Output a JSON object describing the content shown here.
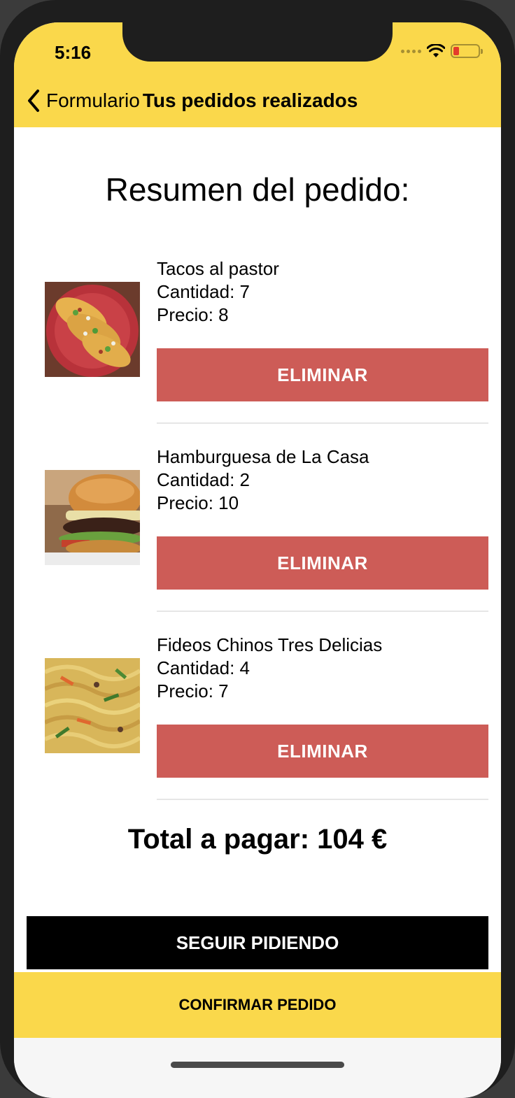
{
  "status_bar": {
    "time": "5:16"
  },
  "nav": {
    "back_label": "Formulario",
    "title": "Tus pedidos realizados"
  },
  "summary_title": "Resumen del pedido:",
  "orders": [
    {
      "name": "Tacos al pastor",
      "quantity": "Cantidad: 7",
      "price": "Precio: 8",
      "image": "tacos-image",
      "delete_label": "ELIMINAR"
    },
    {
      "name": "Hamburguesa de La Casa",
      "quantity": "Cantidad: 2",
      "price": "Precio: 10",
      "image": "burger-image",
      "delete_label": "ELIMINAR"
    },
    {
      "name": "Fideos Chinos Tres Delicias",
      "quantity": "Cantidad: 4",
      "price": "Precio: 7",
      "image": "noodles-image",
      "delete_label": "ELIMINAR"
    }
  ],
  "total": "Total a pagar: 104 €",
  "buttons": {
    "continue": "SEGUIR PIDIENDO",
    "confirm": "CONFIRMAR PEDIDO"
  },
  "colors": {
    "accent": "#fad84b",
    "delete": "#cd5c57",
    "continue_bg": "#000000"
  }
}
